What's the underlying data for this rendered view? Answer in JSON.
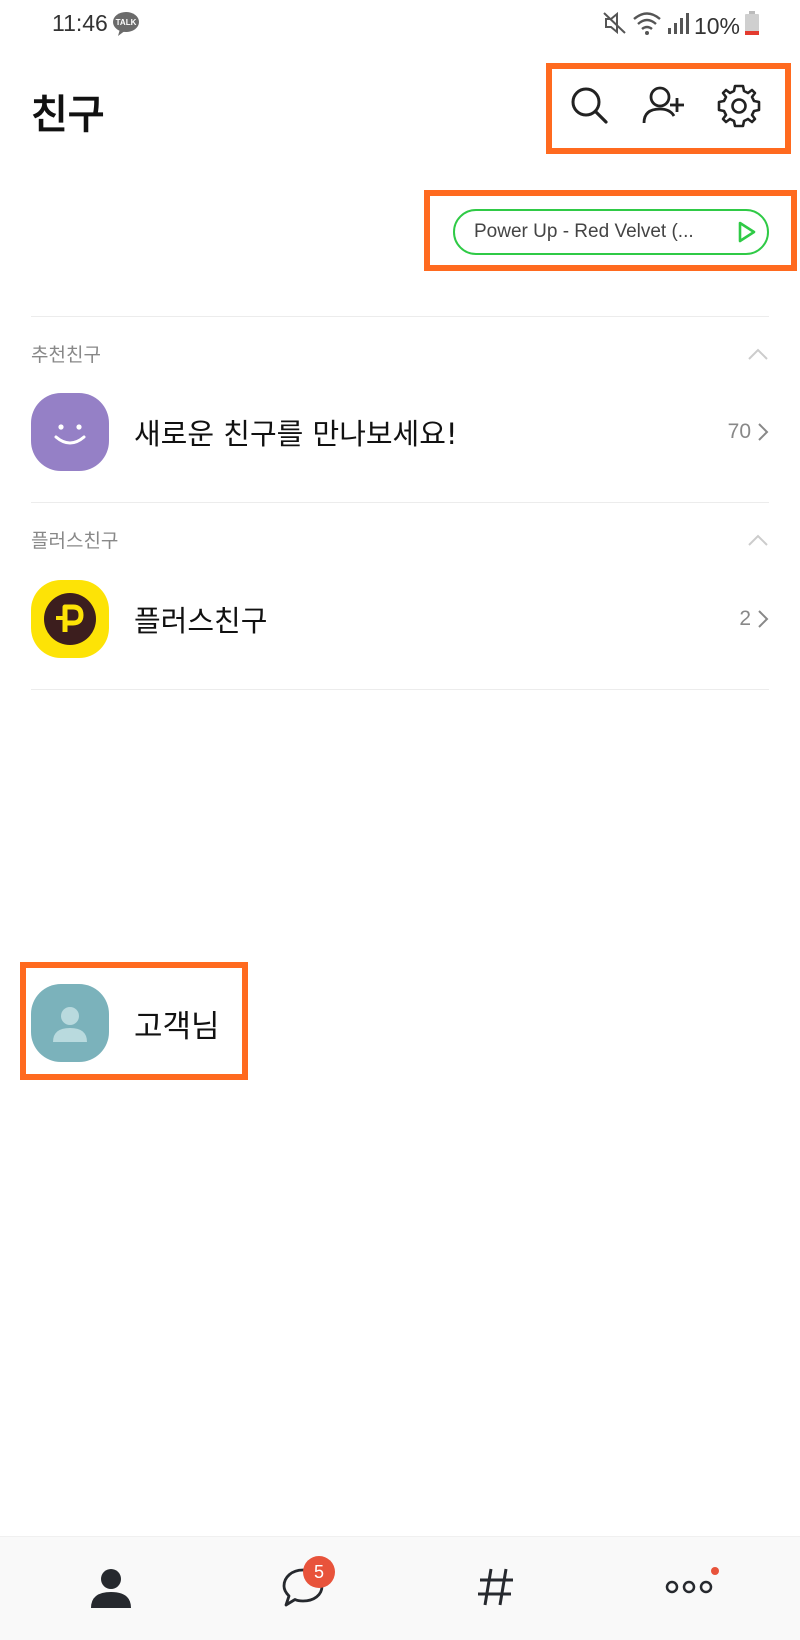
{
  "status_bar": {
    "time": "11:46",
    "talk_badge": "TALK",
    "battery": "10%",
    "icons": [
      "mute-icon",
      "wifi-icon",
      "signal-icon",
      "battery-icon"
    ]
  },
  "header": {
    "title": "친구",
    "icons": [
      "search-icon",
      "add-friend-icon",
      "settings-icon"
    ]
  },
  "profile_music": {
    "text": "Power Up - Red Velvet (...",
    "icon": "play-icon",
    "color": "#2fca46"
  },
  "sections": {
    "recommended": {
      "label": "추천친구",
      "row_label": "새로운 친구를 만나보세요!",
      "count": "70",
      "avatar_color": "#9580c6"
    },
    "plus": {
      "label": "플러스친구",
      "row_label": "플러스친구",
      "count": "2",
      "avatar_color": "#fde306"
    }
  },
  "profile": {
    "name": "고객님",
    "avatar_color": "#7bb2bb"
  },
  "bottom_nav": {
    "items": [
      "friends-icon",
      "chats-icon",
      "hashtag-icon",
      "more-icon"
    ],
    "chat_badge": "5"
  },
  "colors": {
    "highlight": "#ff6a1f",
    "badge": "#e8533b"
  }
}
